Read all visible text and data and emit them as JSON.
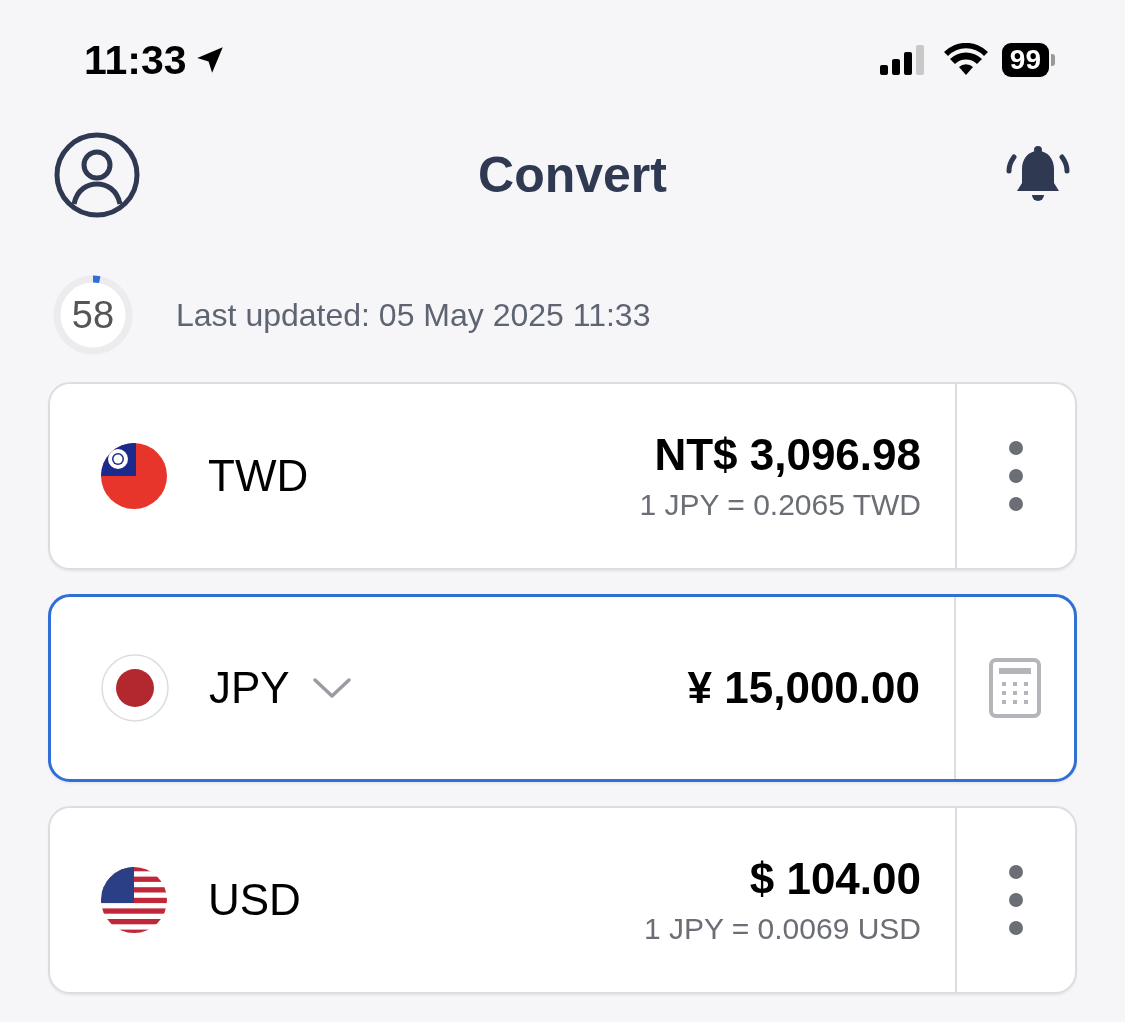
{
  "status_bar": {
    "time": "11:33",
    "battery": "99"
  },
  "header": {
    "title": "Convert"
  },
  "update": {
    "countdown": "58",
    "level": 0.03,
    "text": "Last updated: 05 May 2025 11:33"
  },
  "currencies": [
    {
      "code": "TWD",
      "flag": {
        "kind": "tw"
      },
      "kind": "rate",
      "selected": false,
      "amount": "NT$ 3,096.98",
      "rate": "1 JPY = 0.2065 TWD"
    },
    {
      "code": "JPY",
      "flag": {
        "kind": "jp"
      },
      "kind": "input",
      "selected": true,
      "amount": "¥ 15,000.00"
    },
    {
      "code": "USD",
      "flag": {
        "kind": "us"
      },
      "kind": "rate",
      "selected": false,
      "amount": "$ 104.00",
      "rate": "1 JPY = 0.0069 USD"
    }
  ]
}
